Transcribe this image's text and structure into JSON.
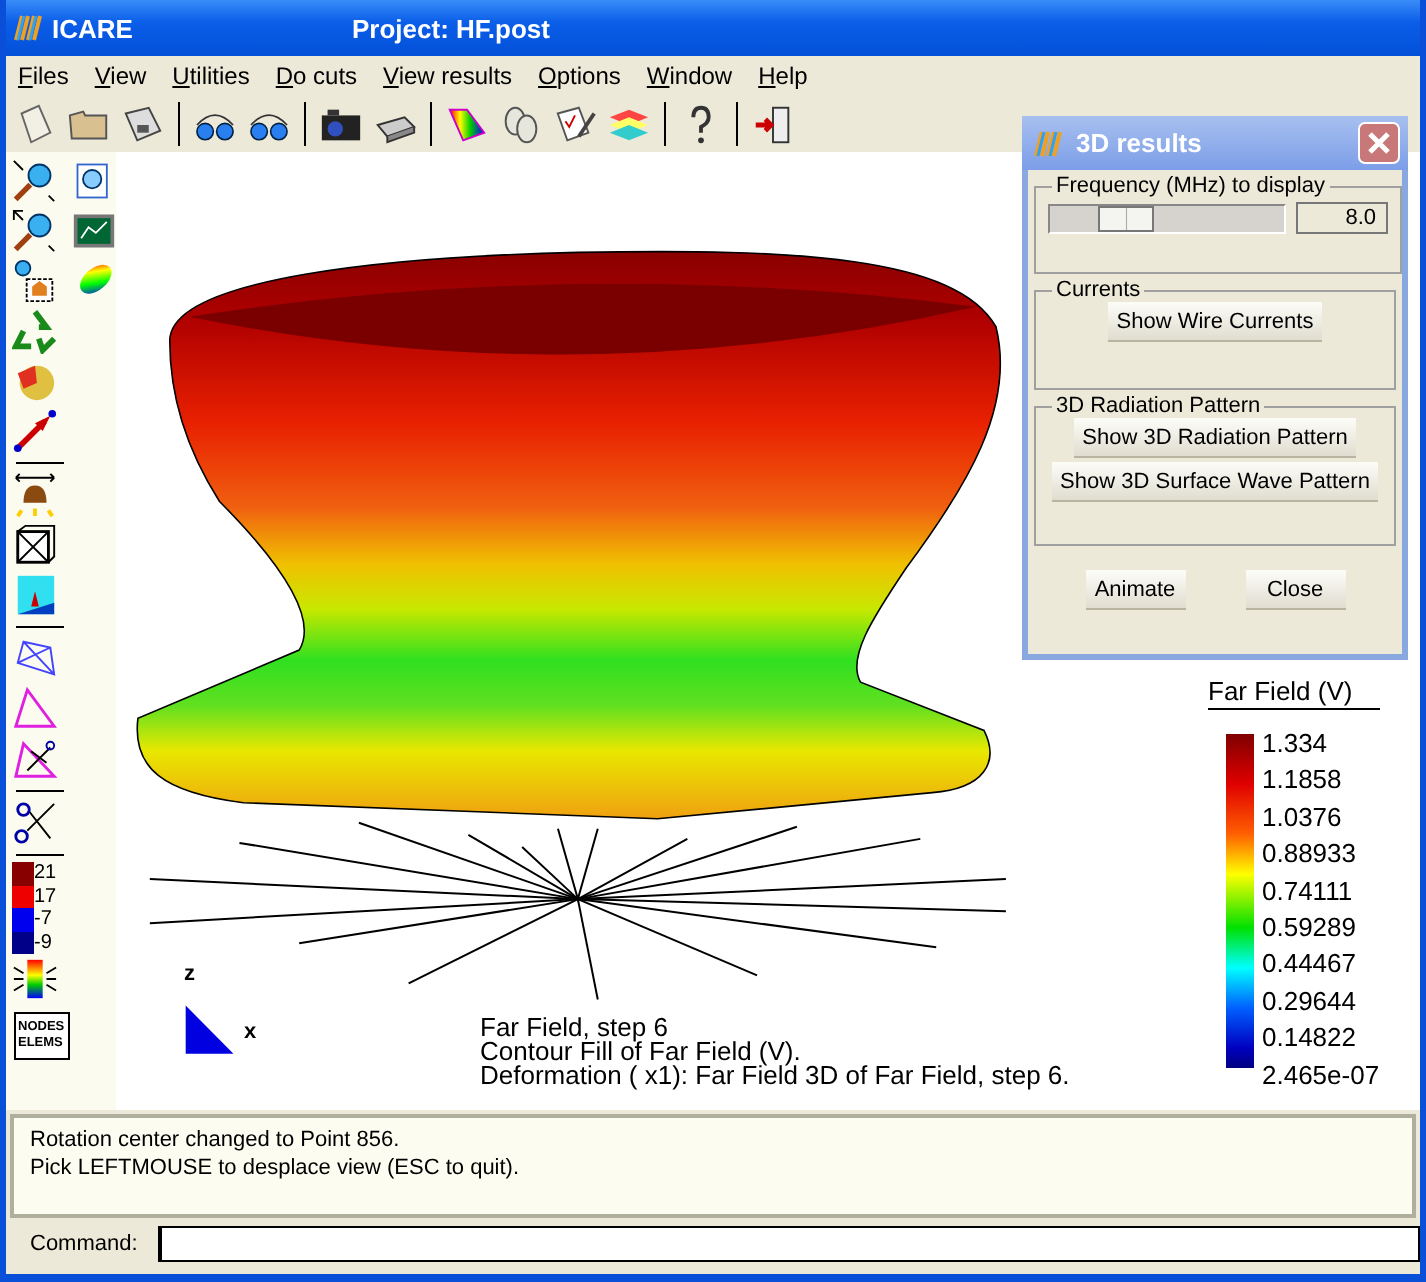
{
  "title_bar": {
    "app_name": "ICARE",
    "title": "Project: HF.post"
  },
  "menu": [
    "Files",
    "View",
    "Utilities",
    "Do cuts",
    "View results",
    "Options",
    "Window",
    "Help"
  ],
  "left_toolbar": {
    "scale_labels": [
      "21",
      "17",
      "-7",
      "-9"
    ],
    "nodes_elems_text": [
      "NODES",
      "ELEMS"
    ]
  },
  "canvas": {
    "axes": {
      "z_label": "z",
      "x_label": "x"
    },
    "info_lines": [
      "Far Field, step 6",
      "Contour Fill of Far Field (V).",
      "Deformation ( x1): Far Field 3D of Far Field, step 6."
    ],
    "legend": {
      "title": "Far Field (V)",
      "labels": [
        "1.334",
        "1.1858",
        "1.0376",
        "0.88933",
        "0.74111",
        "0.59289",
        "0.44467",
        "0.29644",
        "0.14822",
        "2.465e-07"
      ]
    }
  },
  "dialog": {
    "title": "3D results",
    "frequency_group": {
      "label": "Frequency (MHz) to display",
      "level": 0.27,
      "value": "8.0"
    },
    "currents_group": {
      "label": "Currents",
      "buttons": [
        "Show Wire Currents"
      ]
    },
    "pattern_group": {
      "label": "3D Radiation Pattern",
      "buttons": [
        "Show 3D Radiation Pattern",
        "Show 3D Surface Wave Pattern"
      ]
    },
    "buttons": [
      "Animate",
      "Close"
    ]
  },
  "messages": [
    "Rotation center changed to Point 856.",
    "Pick LEFTMOUSE to desplace view (ESC to quit)."
  ],
  "command": {
    "label": "Command:"
  }
}
